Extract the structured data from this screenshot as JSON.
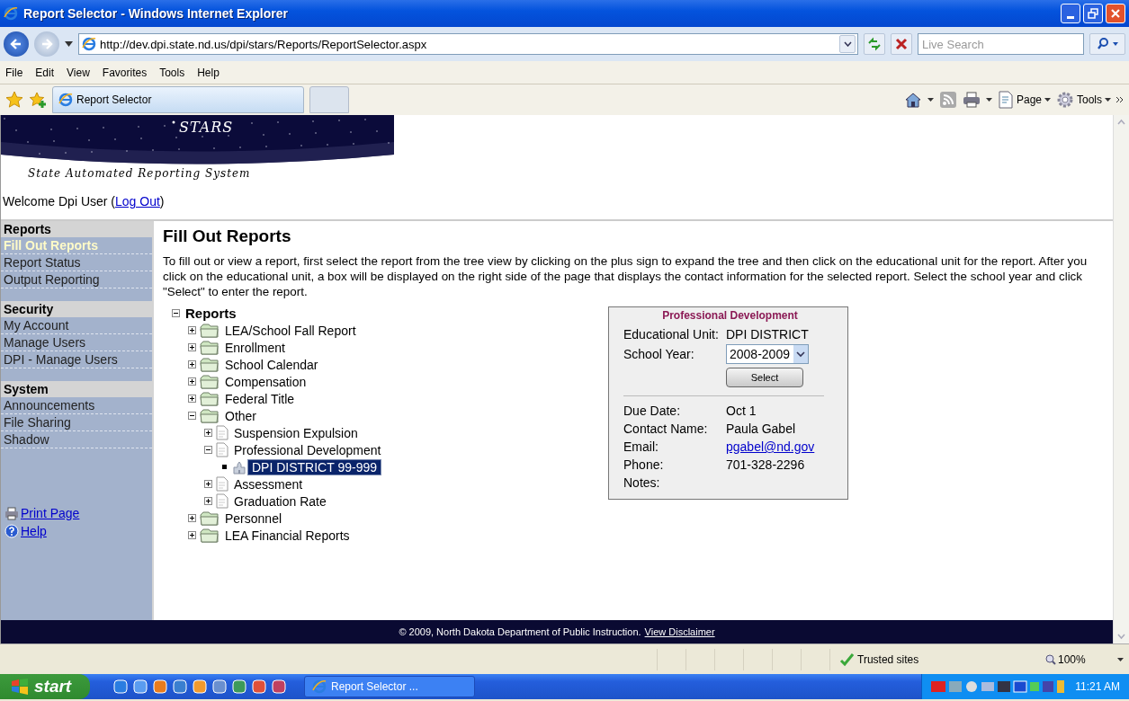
{
  "window": {
    "title": "Report Selector - Windows Internet Explorer"
  },
  "address_bar": {
    "url": "http://dev.dpi.state.nd.us/dpi/stars/Reports/ReportSelector.aspx"
  },
  "search": {
    "placeholder": "Live Search"
  },
  "menu": [
    "File",
    "Edit",
    "View",
    "Favorites",
    "Tools",
    "Help"
  ],
  "tabs": [
    {
      "label": "Report Selector",
      "selected": true
    }
  ],
  "toolbar": {
    "page": "Page",
    "tools": "Tools"
  },
  "banner": {
    "title": "STARS",
    "subtitle": "State Automated Reporting System"
  },
  "welcome": {
    "text": "Welcome Dpi User (",
    "link": "Log Out",
    "end": ")"
  },
  "sidebar": {
    "sections": [
      {
        "heading": "Reports",
        "items": [
          {
            "label": "Fill Out Reports",
            "selected": true
          },
          {
            "label": "Report Status",
            "selected": false
          },
          {
            "label": "Output Reporting",
            "selected": false
          }
        ]
      },
      {
        "heading": "Security",
        "items": [
          {
            "label": "My Account",
            "selected": false
          },
          {
            "label": "Manage Users",
            "selected": false
          },
          {
            "label": "DPI - Manage Users",
            "selected": false
          }
        ]
      },
      {
        "heading": "System",
        "items": [
          {
            "label": "Announcements",
            "selected": false
          },
          {
            "label": "File Sharing",
            "selected": false
          },
          {
            "label": "Shadow",
            "selected": false
          }
        ]
      }
    ],
    "links": [
      {
        "kind": "print",
        "label": "Print Page"
      },
      {
        "kind": "help",
        "label": "Help"
      }
    ]
  },
  "main": {
    "heading": "Fill Out Reports",
    "instructions": "To fill out or view a report, first select the report from the tree view by clicking on the plus sign to expand the tree and then click on the educational unit for the report. After you click on the educational unit, a box will be displayed on the right side of the page that displays the contact information for the selected report. Select the school year and click \"Select\" to enter the report."
  },
  "tree": {
    "kind": "root",
    "label": "Reports",
    "expanded": true,
    "selected": false,
    "children": [
      {
        "kind": "folder",
        "label": "LEA/School Fall Report",
        "expanded": false,
        "selected": false
      },
      {
        "kind": "folder",
        "label": "Enrollment",
        "expanded": false,
        "selected": false
      },
      {
        "kind": "folder",
        "label": "School Calendar",
        "expanded": false,
        "selected": false
      },
      {
        "kind": "folder",
        "label": "Compensation",
        "expanded": false,
        "selected": false
      },
      {
        "kind": "folder",
        "label": "Federal Title",
        "expanded": false,
        "selected": false
      },
      {
        "kind": "folder",
        "label": "Other",
        "expanded": true,
        "selected": false,
        "children": [
          {
            "kind": "document",
            "label": "Suspension Expulsion",
            "expanded": false,
            "selected": false
          },
          {
            "kind": "document",
            "label": "Professional Development",
            "expanded": true,
            "selected": false,
            "children": [
              {
                "kind": "unit",
                "label": "DPI DISTRICT 99-999",
                "selected": true
              }
            ]
          },
          {
            "kind": "document",
            "label": "Assessment",
            "expanded": false,
            "selected": false
          },
          {
            "kind": "document",
            "label": "Graduation Rate",
            "expanded": false,
            "selected": false
          }
        ]
      },
      {
        "kind": "folder",
        "label": "Personnel",
        "expanded": false,
        "selected": false
      },
      {
        "kind": "folder",
        "label": "LEA Financial Reports",
        "expanded": false,
        "selected": false
      }
    ]
  },
  "detail": {
    "title": "Professional Development",
    "unit": {
      "label": "Educational Unit:",
      "value": "DPI DISTRICT"
    },
    "year": {
      "label": "School Year:",
      "value": "2008-2009"
    },
    "button": "Select",
    "rows": [
      {
        "kind": "text",
        "label": "Due Date:",
        "value": "Oct 1"
      },
      {
        "kind": "text",
        "label": "Contact Name:",
        "value": "Paula Gabel"
      },
      {
        "kind": "link",
        "label": "Email:",
        "value": "pgabel@nd.gov"
      },
      {
        "kind": "text",
        "label": "Phone:",
        "value": "701-328-2296"
      },
      {
        "label": "Notes:"
      }
    ]
  },
  "footer": {
    "text": "© 2009, North Dakota Department of Public Instruction.",
    "link": "View Disclaimer"
  },
  "status_bar": {
    "zone": "Trusted sites",
    "zoom": "100%"
  },
  "taskbar": {
    "start": "start",
    "windows": [
      {
        "label": "Report Selector ...",
        "selected": false
      }
    ],
    "clock": "11:21 AM"
  }
}
